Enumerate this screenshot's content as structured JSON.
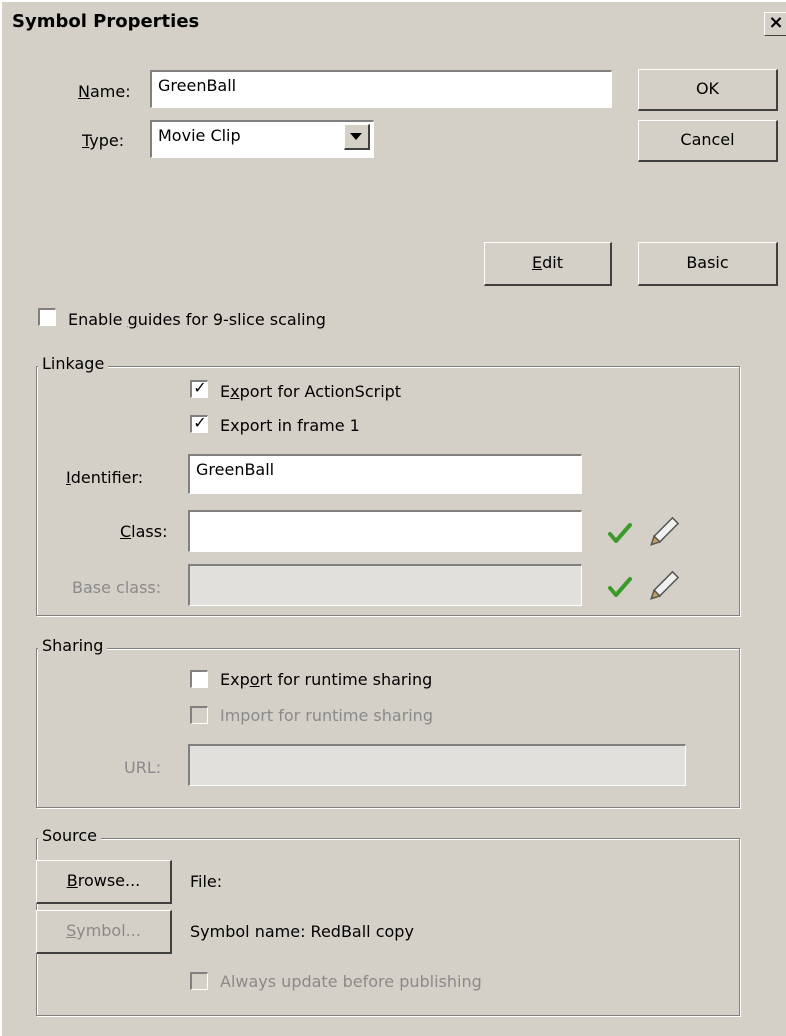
{
  "window": {
    "title": "Symbol Properties",
    "close": "×"
  },
  "name": {
    "label_pre": "",
    "label_u": "N",
    "label_post": "ame:",
    "value": "GreenBall"
  },
  "type": {
    "label_u": "T",
    "label_post": "ype:",
    "value": "Movie Clip"
  },
  "buttons": {
    "ok": "OK",
    "cancel": "Cancel",
    "edit_u": "E",
    "edit_post": "dit",
    "basic": "Basic"
  },
  "guides": {
    "pre": "Enable ",
    "u": "g",
    "post": "uides for 9-slice scaling",
    "checked": false
  },
  "linkage": {
    "title": "Linkage",
    "export_as": {
      "pre": "E",
      "u": "x",
      "post": "port for ActionScript",
      "checked": true
    },
    "export_frame": {
      "pre": "Export in frame 1",
      "checked": true
    },
    "identifier_label_u": "I",
    "identifier_label_post": "dentifier:",
    "identifier_value": "GreenBall",
    "class_label_u": "C",
    "class_label_post": "lass:",
    "class_value": "",
    "base_class_label": "Base class:",
    "base_class_value": ""
  },
  "sharing": {
    "title": "Sharing",
    "export_runtime": {
      "pre": "Exp",
      "u": "o",
      "post": "rt for runtime sharing",
      "checked": false
    },
    "import_runtime": {
      "pre": "",
      "u": "I",
      "mid": "m",
      "u2": "p",
      "post": "ort for runtime sharing",
      "full": "Import for runtime sharing",
      "checked": false
    },
    "url_label": "URL:",
    "url_value": ""
  },
  "source": {
    "title": "Source",
    "browse_u": "B",
    "browse_post": "rowse...",
    "symbol_u": "S",
    "symbol_post": "ymbol...",
    "file_label": "File:",
    "symbol_name": "Symbol name: RedBall copy",
    "always_update": "Always update before publishing"
  },
  "colors": {
    "check_green": "#3a9a2a",
    "pencil": "#777777",
    "bg": "#d4d0c8"
  }
}
